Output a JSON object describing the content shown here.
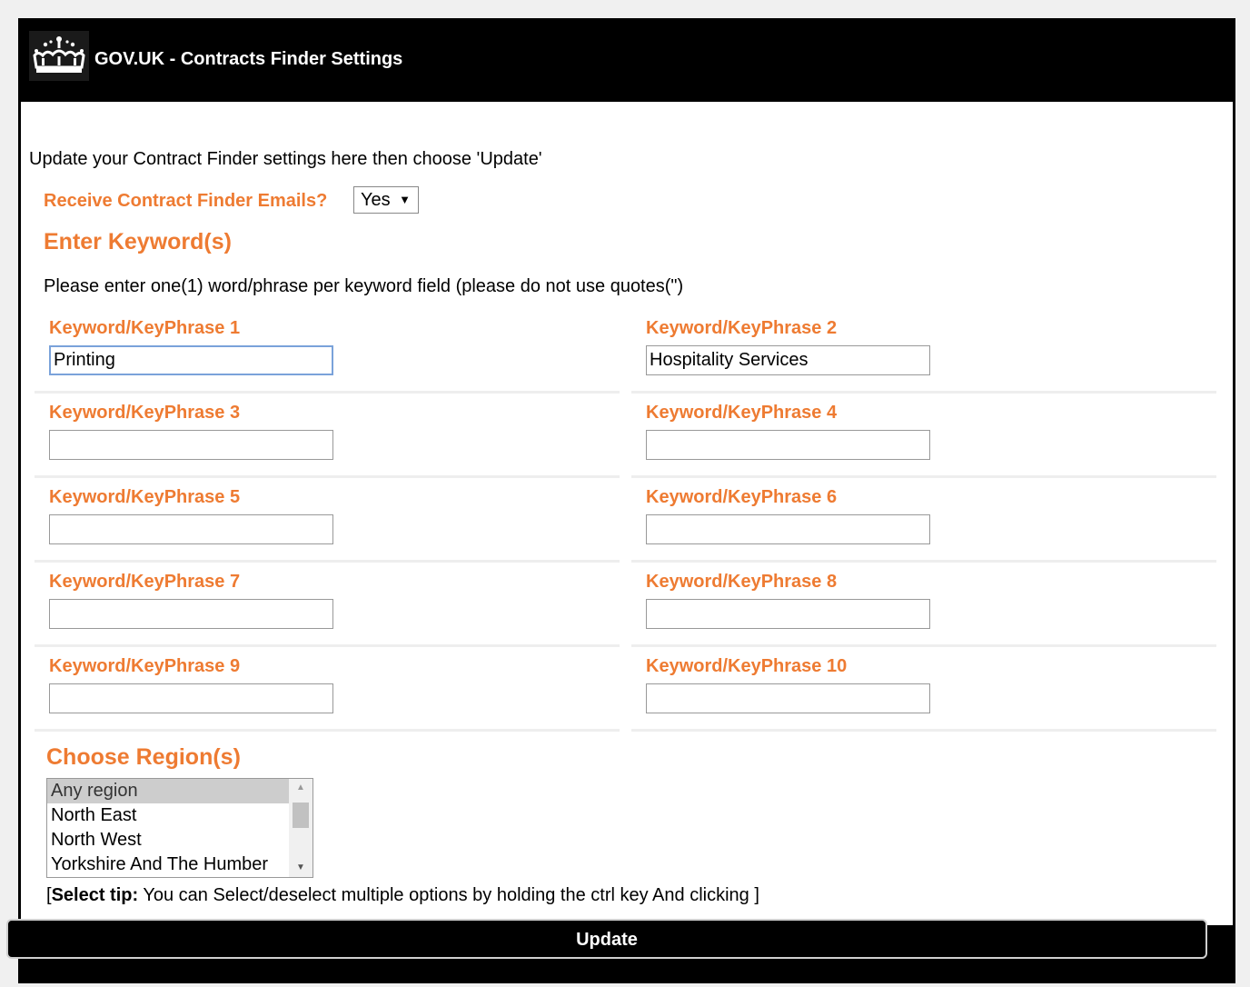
{
  "header": {
    "title": "GOV.UK - Contracts Finder Settings",
    "logo_icon": "crown-icon"
  },
  "intro": "Update your Contract Finder settings here then choose 'Update'",
  "emails": {
    "label": "Receive Contract Finder Emails?",
    "value": "Yes"
  },
  "keywords": {
    "heading": "Enter Keyword(s)",
    "help": "Please enter one(1) word/phrase per keyword field (please do not use quotes(\")",
    "fields": [
      {
        "label": "Keyword/KeyPhrase 1",
        "value": "Printing"
      },
      {
        "label": "Keyword/KeyPhrase 2",
        "value": "Hospitality Services"
      },
      {
        "label": "Keyword/KeyPhrase 3",
        "value": ""
      },
      {
        "label": "Keyword/KeyPhrase 4",
        "value": ""
      },
      {
        "label": "Keyword/KeyPhrase 5",
        "value": ""
      },
      {
        "label": "Keyword/KeyPhrase 6",
        "value": ""
      },
      {
        "label": "Keyword/KeyPhrase 7",
        "value": ""
      },
      {
        "label": "Keyword/KeyPhrase 8",
        "value": ""
      },
      {
        "label": "Keyword/KeyPhrase 9",
        "value": ""
      },
      {
        "label": "Keyword/KeyPhrase 10",
        "value": ""
      }
    ]
  },
  "regions": {
    "heading": "Choose Region(s)",
    "options": [
      "Any region",
      "North East",
      "North West",
      "Yorkshire And The Humber"
    ],
    "selected": "Any region"
  },
  "tip": {
    "prefix": "[",
    "bold": "Select tip:",
    "text": " You can Select/deselect multiple options by holding the ctrl key And clicking ]"
  },
  "update_button": "Update",
  "colors": {
    "accent": "#ee7b32",
    "header_bg": "#000000"
  }
}
